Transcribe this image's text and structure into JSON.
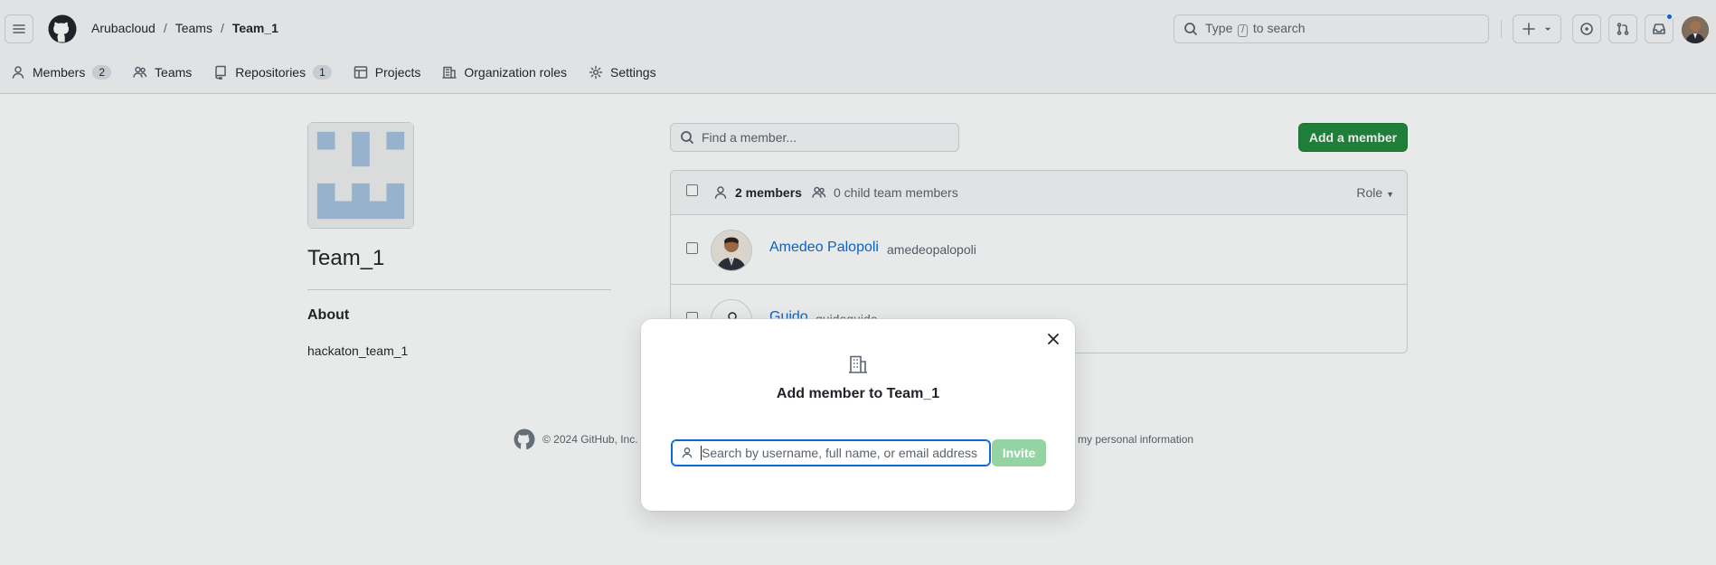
{
  "header": {
    "breadcrumbs": [
      "Arubacloud",
      "Teams",
      "Team_1"
    ],
    "breadcrumb_separator": "/",
    "search": {
      "prefix": "Type",
      "key": "/",
      "suffix": "to search"
    },
    "icons": [
      "menu-icon",
      "github-logo-icon",
      "search-icon",
      "plus-icon",
      "chevron-down-icon",
      "issue-icon",
      "pull-request-icon",
      "inbox-icon",
      "avatar"
    ]
  },
  "org_nav": {
    "items": [
      {
        "label": "Members",
        "count": "2",
        "icon": "person-icon"
      },
      {
        "label": "Teams",
        "icon": "people-icon"
      },
      {
        "label": "Repositories",
        "count": "1",
        "icon": "repo-icon"
      },
      {
        "label": "Projects",
        "icon": "table-icon"
      },
      {
        "label": "Organization roles",
        "icon": "organization-icon"
      },
      {
        "label": "Settings",
        "icon": "gear-icon"
      }
    ]
  },
  "team": {
    "name": "Team_1",
    "about_heading": "About",
    "description": "hackaton_team_1"
  },
  "members": {
    "find_placeholder": "Find a member...",
    "add_button": "Add a member",
    "count_label": "2 members",
    "child_label": "0 child team members",
    "role_filter": "Role",
    "list": [
      {
        "name": "Amedeo Palopoli",
        "login": "amedeopalopoli"
      },
      {
        "name": "Guido",
        "login": "guidoguido"
      }
    ]
  },
  "footer": {
    "copyright": "© 2024 GitHub, Inc.",
    "right_link": "my personal information"
  },
  "dialog": {
    "title": "Add member to Team_1",
    "search_placeholder": "Search by username, full name, or email address",
    "invite_button": "Invite",
    "icon": "organization-icon"
  },
  "colors": {
    "primary_button": "#1f883d",
    "invite_disabled": "#94d3a2",
    "link": "#0969da",
    "notification_dot": "#0969da"
  }
}
